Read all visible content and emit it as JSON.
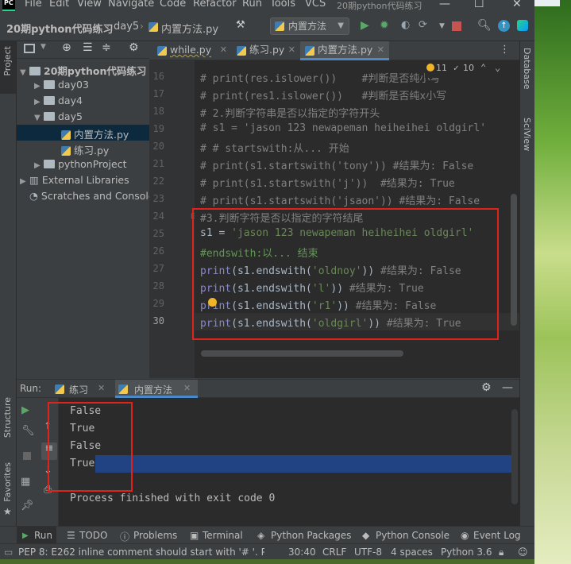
{
  "colors": {
    "accent": "#4a88c7",
    "highlight_box": "#e0221a",
    "run_green": "#59a869",
    "selection": "#214283"
  },
  "menubar": {
    "logo": "PC",
    "items": [
      "File",
      "Edit",
      "View",
      "Navigate",
      "Code",
      "Refactor",
      "Run",
      "Tools",
      "VCS"
    ],
    "window_title": "20期python代码练习"
  },
  "navbar": {
    "breadcrumbs": [
      "20期python代码练习",
      "day5",
      "内置方法.py"
    ],
    "run_config": "内置方法"
  },
  "left_stripe": {
    "project_label": "Project",
    "structure_label": "Structure",
    "favorites_label": "Favorites"
  },
  "right_stripe": {
    "database_label": "Database",
    "sciview_label": "SciView"
  },
  "project_tree": [
    {
      "label": "20期python代码练习",
      "type": "folder"
    },
    {
      "label": "day03",
      "type": "folder"
    },
    {
      "label": "day4",
      "type": "folder"
    },
    {
      "label": "day5",
      "type": "folder"
    },
    {
      "label": "内置方法.py",
      "type": "py"
    },
    {
      "label": "练习.py",
      "type": "py"
    },
    {
      "label": "pythonProject",
      "type": "folder"
    },
    {
      "label": "External Libraries",
      "type": "lib"
    },
    {
      "label": "Scratches and Consoles",
      "type": "scratch"
    }
  ],
  "editor": {
    "tabs": [
      "while.py",
      "练习.py",
      "内置方法.py"
    ],
    "warnings_count": "11",
    "weak_warnings_count": "10",
    "line_numbers": [
      "16",
      "17",
      "18",
      "19",
      "20",
      "21",
      "22",
      "23",
      "24",
      "25",
      "26",
      "27",
      "28",
      "29",
      "30"
    ],
    "lines": {
      "l16a": "# print(res.islower())",
      "l16b": "#判断是否纯小写",
      "l17a": "# print(res1.islower())",
      "l17b": "#判断是否纯x小写",
      "l18": "# 2.判断字符串是否以指定的字符开头",
      "l19": "# s1 = 'jason 123 newapeman heiheihei oldgirl'",
      "l20": "# # startswith:从... 开始",
      "l21": "# print(s1.startswith('tony')) #结果为: False",
      "l22": "# print(s1.startswith('j'))  #结果为: True",
      "l23": "# print(s1.startswith('jsaon')) #结果为: False",
      "l24": "#3.判断字符是否以指定的字符结尾",
      "l25_var": "s1 = ",
      "l25_str": "'jason 123 newapeman heiheihei oldgirl'",
      "l26": "#endswith:以... 结束",
      "l27_fn": "print",
      "l27_mid": "(s1.endswith(",
      "l27_str": "'oldnoy'",
      "l27_end": ")) ",
      "l27_cm": "#结果为: False",
      "l28_fn": "print",
      "l28_mid": "(s1.endswith(",
      "l28_str": "'l'",
      "l28_end": ")) ",
      "l28_cm": "#结果为: True",
      "l29_fn": "print",
      "l29_mid": "(s1.endswith(",
      "l29_str": "'r1'",
      "l29_end": ")) ",
      "l29_cm": "#结果为: False",
      "l30_fn": "print",
      "l30_mid": "(s1.endswith(",
      "l30_str": "'oldgirl'",
      "l30_end": ")) ",
      "l30_cm": "#结果为: True"
    }
  },
  "run_panel": {
    "label": "Run:",
    "tabs": [
      "练习",
      "内置方法"
    ],
    "output": [
      "False",
      "True",
      "False",
      "True"
    ],
    "finished": "Process finished with exit code 0"
  },
  "tool_strip": [
    "Run",
    "TODO",
    "Problems",
    "Terminal",
    "Python Packages",
    "Python Console",
    "Event Log"
  ],
  "status_bar": {
    "message": "PEP 8: E262 inline comment should start with '# '. PE...",
    "position": "30:40",
    "line_sep": "CRLF",
    "encoding": "UTF-8",
    "indent": "4 spaces",
    "interpreter": "Python 3.6"
  }
}
